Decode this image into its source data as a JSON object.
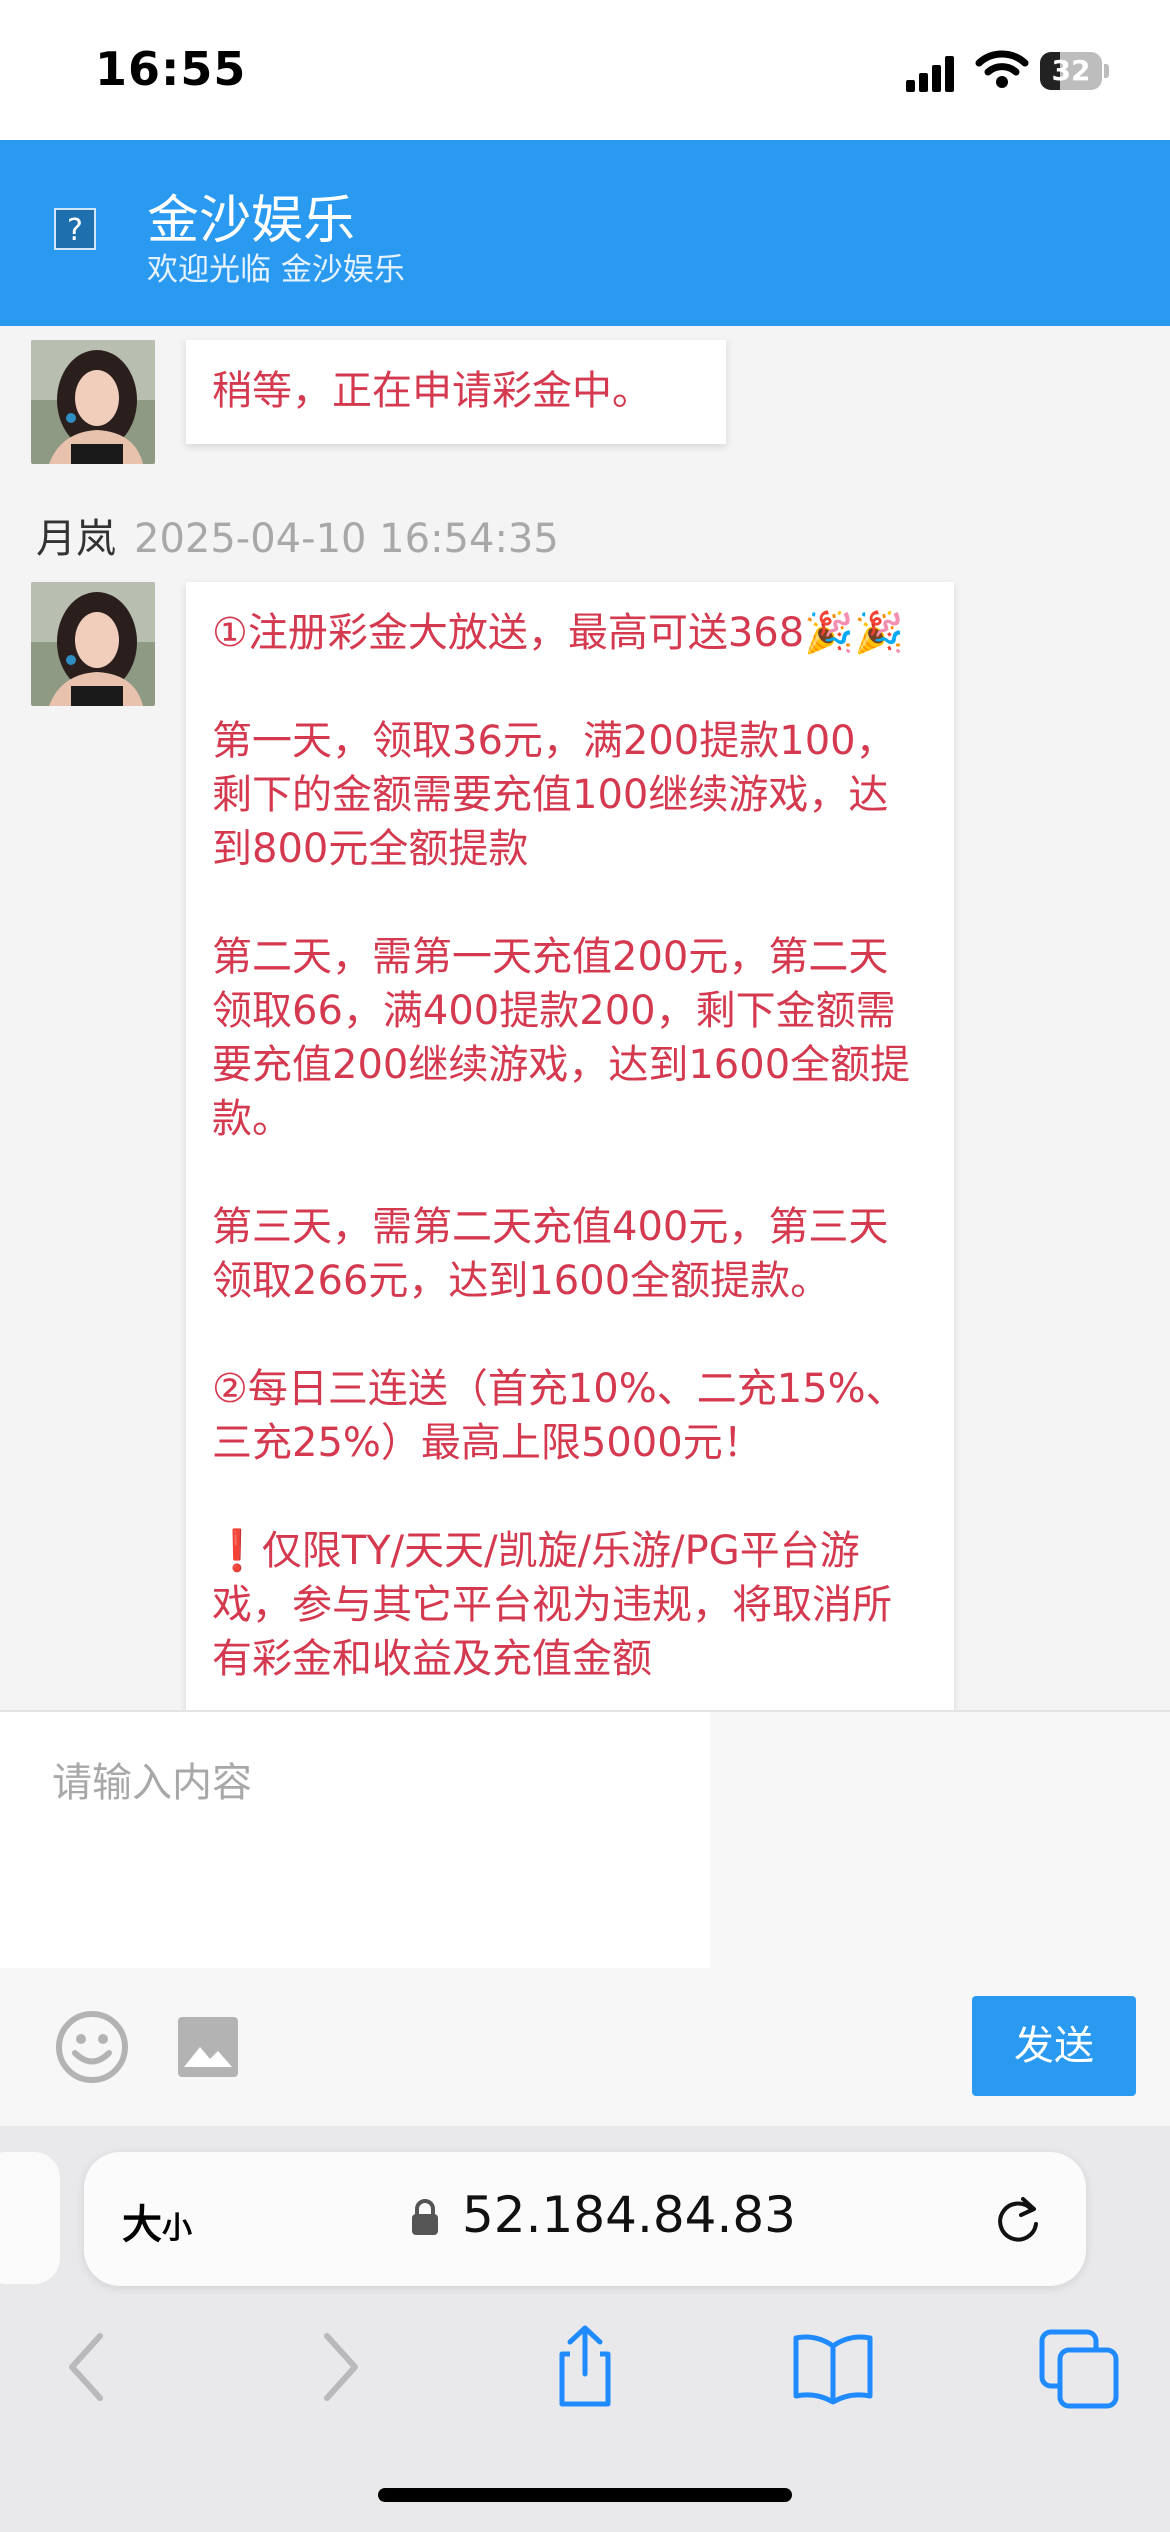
{
  "status_bar": {
    "time": "16:55",
    "battery": "32",
    "battery_level": 0.32
  },
  "header": {
    "title": "金沙娱乐",
    "subtitle": "欢迎光临 金沙娱乐"
  },
  "messages": [
    {
      "text": "稍等，正在申请彩金中。"
    },
    {
      "sender": "月岚",
      "time": "2025-04-10 16:54:35",
      "paragraphs": [
        "①注册彩金大放送，最高可送368🎉🎉",
        "第一天，领取36元，满200提款100，剩下的金额需要充值100继续游戏，达到800元全额提款",
        "第二天，需第一天充值200元，第二天领取66，满400提款200，剩下金额需要充值200继续游戏，达到1600全额提款。",
        "第三天，需第二天充值400元，第三天领取266元，达到1600全额提款。",
        "②每日三连送（首充10%、二充15%、三充25%）最高上限5000元！",
        "❗仅限TY/天天/凯旋/乐游/PG平台游戏，参与其它平台视为违规，将取消所有彩金和收益及充值金额"
      ]
    }
  ],
  "input": {
    "placeholder": "请输入内容",
    "send_label": "发送"
  },
  "browser": {
    "aa_main": "大",
    "aa_small": "小",
    "url": "52.184.84.83"
  },
  "colors": {
    "accent": "#2a9af1",
    "message_text": "#d4394f"
  }
}
